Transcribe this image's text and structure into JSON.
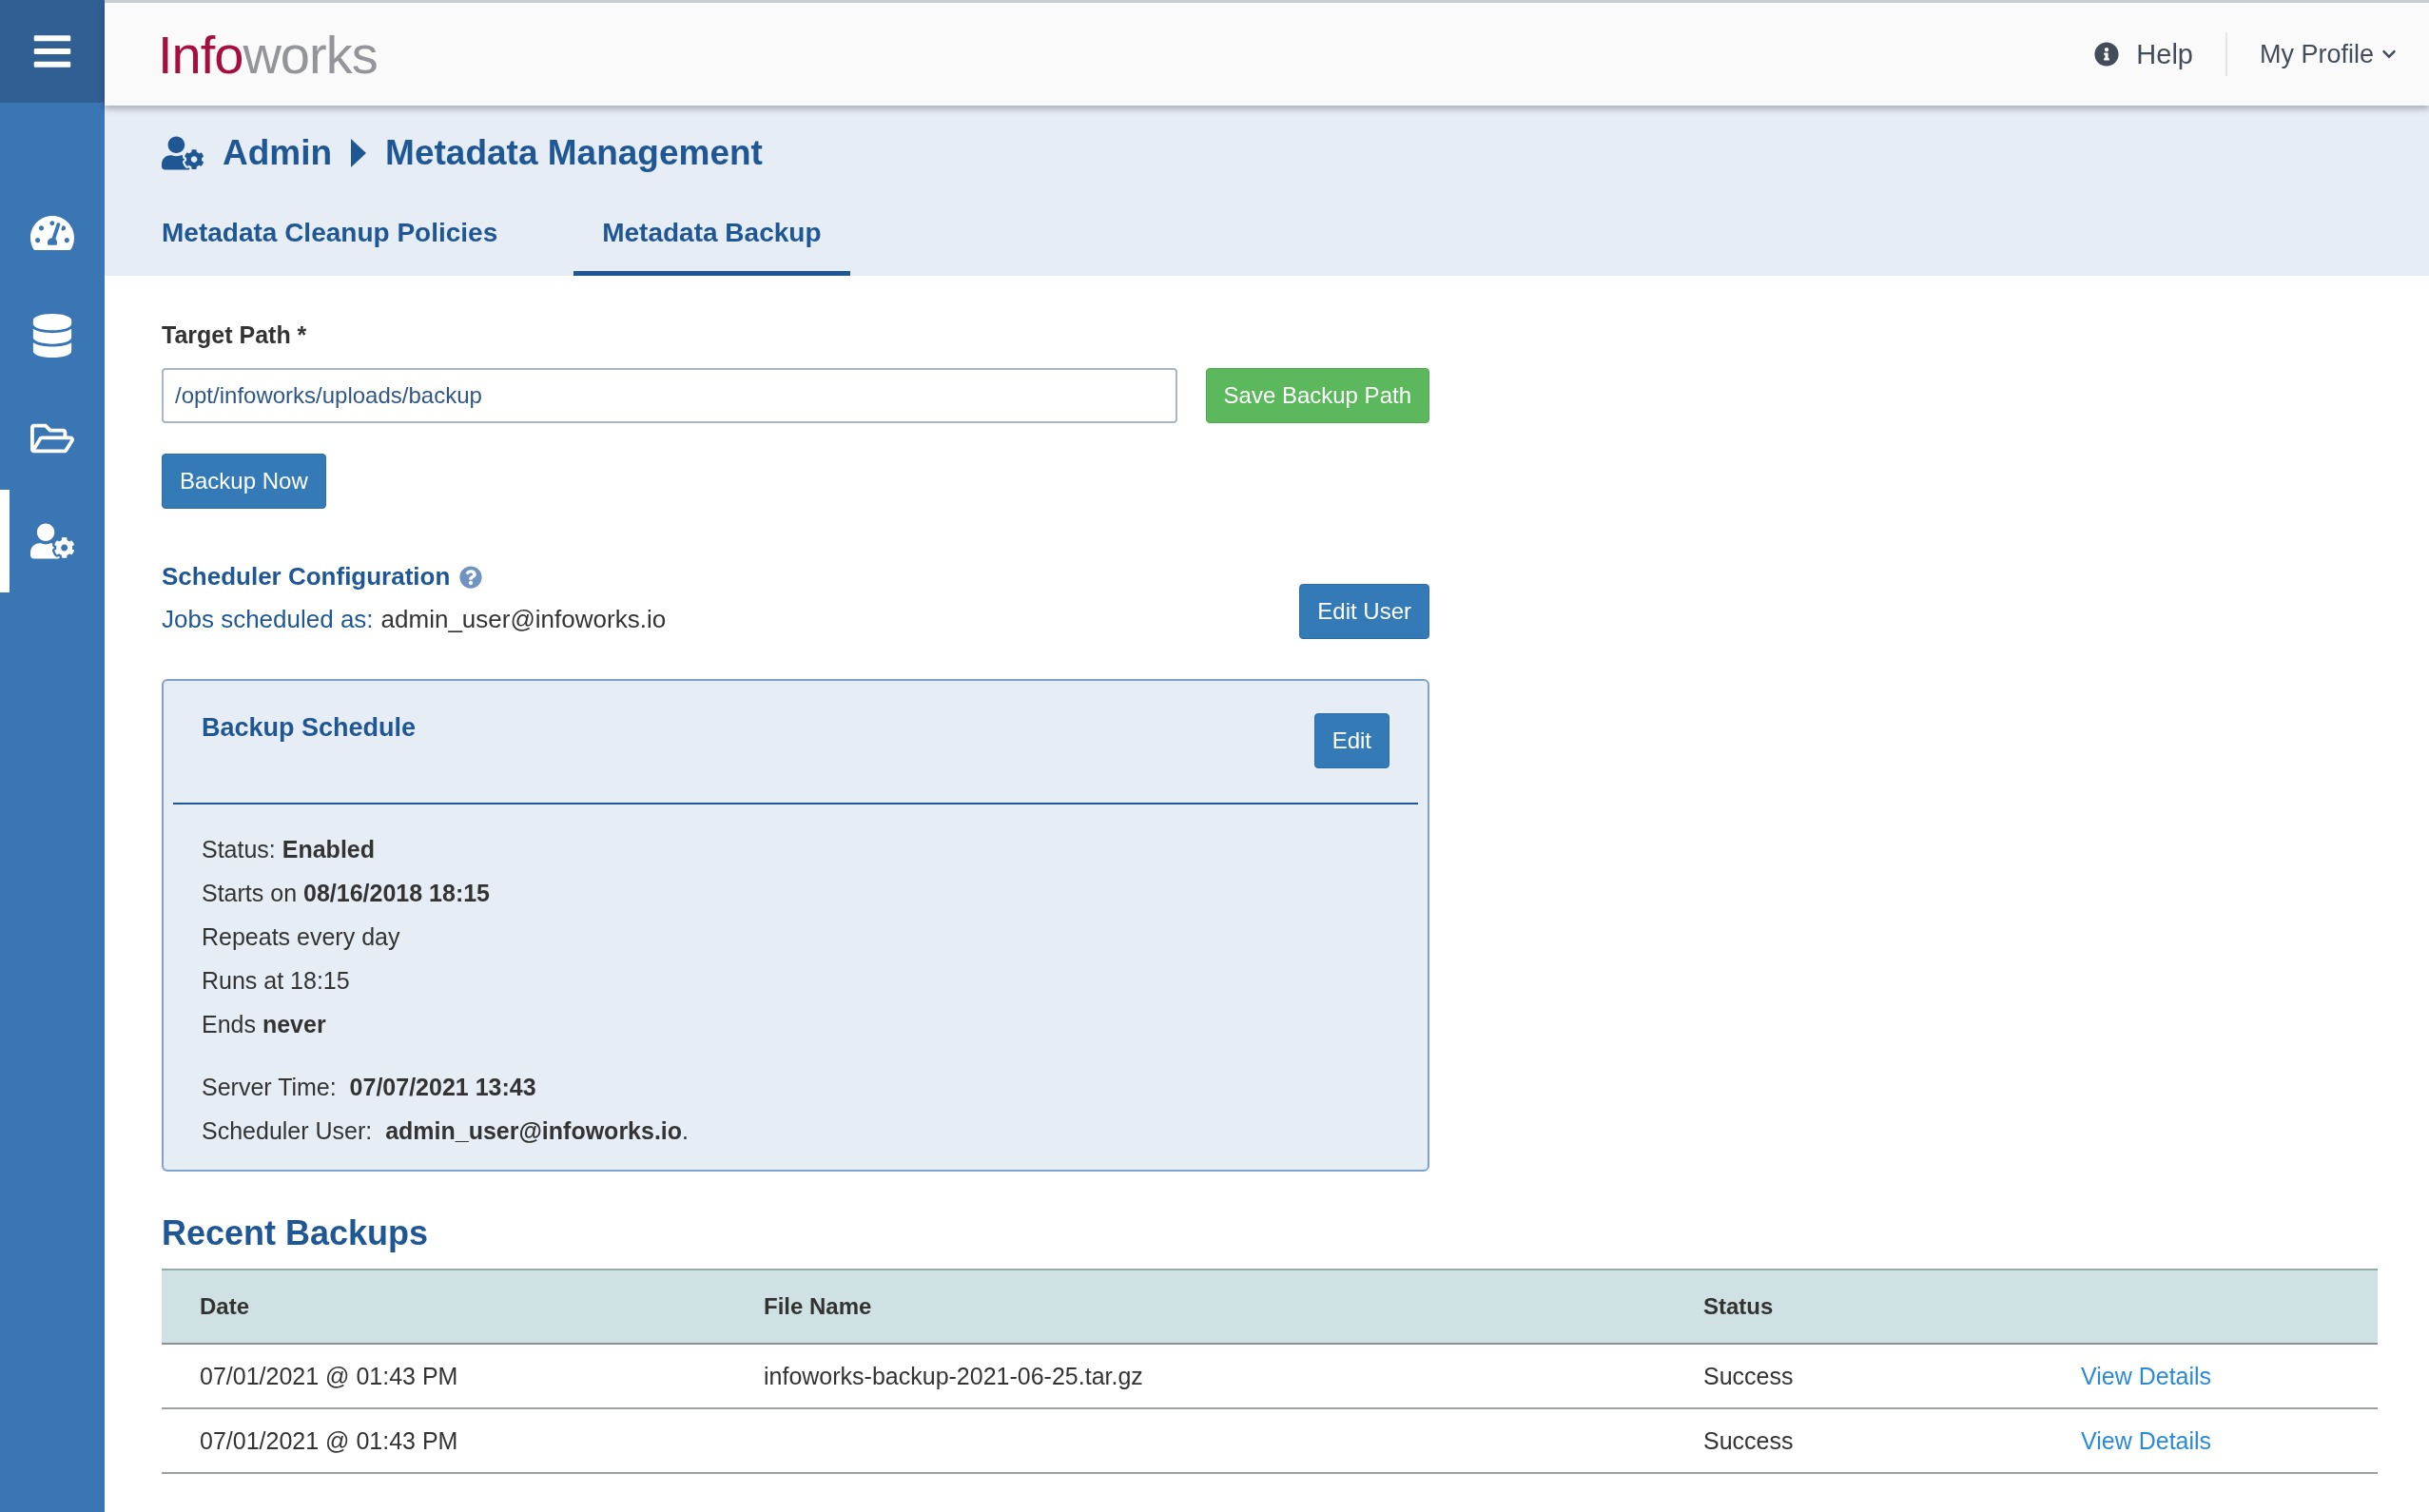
{
  "header": {
    "logo_part1": "Info",
    "logo_part2": "works",
    "help": "Help",
    "profile": "My Profile"
  },
  "sidebar": {
    "items": [
      {
        "kind": "dashboard",
        "selected": false
      },
      {
        "kind": "database",
        "selected": false
      },
      {
        "kind": "folder",
        "selected": false
      },
      {
        "kind": "admin",
        "selected": true
      }
    ]
  },
  "breadcrumb": [
    "Admin",
    "Metadata Management"
  ],
  "tabs": [
    {
      "label": "Metadata Cleanup Policies",
      "selected": false
    },
    {
      "label": "Metadata Backup",
      "selected": true
    }
  ],
  "target_path": {
    "label": "Target Path *",
    "value": "/opt/infoworks/uploads/backup",
    "save_button": "Save Backup Path",
    "backup_button": "Backup Now"
  },
  "scheduler": {
    "title": "Scheduler Configuration",
    "jobs_label": "Jobs scheduled as:",
    "jobs_user": "admin_user@infoworks.io",
    "edit_user_button": "Edit User"
  },
  "backup_schedule": {
    "title": "Backup Schedule",
    "edit_button": "Edit",
    "lines": [
      "Status: **Enabled**",
      "Starts on **08/16/2018 18:15**",
      "Repeats every day",
      "Runs at 18:15",
      "Ends **never**"
    ],
    "server_lines": [
      "Server Time:  **07/07/2021 13:43**",
      "Scheduler User:  **admin_user@infoworks.io**."
    ]
  },
  "recent_backups": {
    "title": "Recent Backups",
    "columns": [
      "Date",
      "File Name",
      "Status"
    ],
    "rows": [
      {
        "date": "07/01/2021 @ 01:43 PM",
        "file_name": "infoworks-backup-2021-06-25.tar.gz",
        "status": "Success",
        "link": "View Details"
      },
      {
        "date": "07/01/2021 @ 01:43 PM",
        "status": "Success",
        "link": "View Details"
      }
    ]
  }
}
